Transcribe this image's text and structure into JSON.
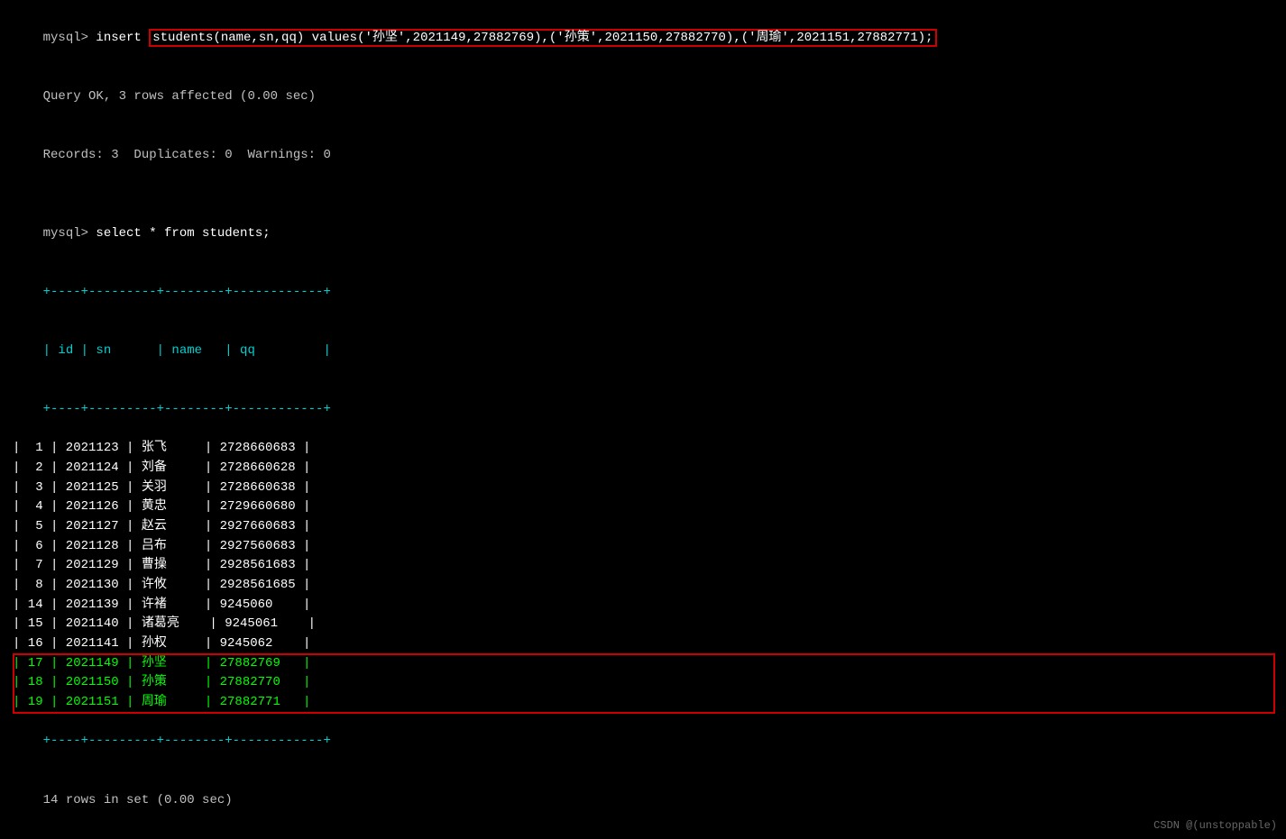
{
  "terminal": {
    "insert_prompt": "mysql> ",
    "insert_cmd_pre": "insert ",
    "insert_cmd_highlight": "students(name,sn,qq) values('孙坚',2021149,27882769),('孙策',2021150,27882770),('周瑜',2021151,27882771);",
    "query_ok": "Query OK, 3 rows affected (0.00 sec)",
    "records": "Records: 3  Duplicates: 0  Warnings: 0",
    "blank1": "",
    "select_prompt": "mysql> ",
    "select_cmd": "select * from students;",
    "sep1": "+----+---------+--------+------------+",
    "header": "| id | sn      | name   | qq         |",
    "sep2": "+----+---------+--------+------------+",
    "rows": [
      {
        "id": " 1",
        "sn": "2021123",
        "name": "张飞",
        "qq": "2728660683",
        "highlight": false
      },
      {
        "id": " 2",
        "sn": "2021124",
        "name": "刘备",
        "qq": "2728660628",
        "highlight": false
      },
      {
        "id": " 3",
        "sn": "2021125",
        "name": "关羽",
        "qq": "2728660638",
        "highlight": false
      },
      {
        "id": " 4",
        "sn": "2021126",
        "name": "黄忠",
        "qq": "2729660680",
        "highlight": false
      },
      {
        "id": " 5",
        "sn": "2021127",
        "name": "赵云",
        "qq": "2927660683",
        "highlight": false
      },
      {
        "id": " 6",
        "sn": "2021128",
        "name": "吕布",
        "qq": "2927560683",
        "highlight": false
      },
      {
        "id": " 7",
        "sn": "2021129",
        "name": "曹操",
        "qq": "2928561683",
        "highlight": false
      },
      {
        "id": " 8",
        "sn": "2021130",
        "name": "许攸",
        "qq": "2928561685",
        "highlight": false
      },
      {
        "id": "14",
        "sn": "2021139",
        "name": "许褚",
        "qq": "9245060   ",
        "highlight": false
      },
      {
        "id": "15",
        "sn": "2021140",
        "name": "诸葛亮",
        "qq": "9245061   ",
        "highlight": false
      },
      {
        "id": "16",
        "sn": "2021141",
        "name": "孙权",
        "qq": "9245062   ",
        "highlight": false
      },
      {
        "id": "17",
        "sn": "2021149",
        "name": "孙坚",
        "qq": "27882769  ",
        "highlight": true
      },
      {
        "id": "18",
        "sn": "2021150",
        "name": "孙策",
        "qq": "27882770  ",
        "highlight": true
      },
      {
        "id": "19",
        "sn": "2021151",
        "name": "周瑜",
        "qq": "27882771  ",
        "highlight": true
      }
    ],
    "sep3": "+----+---------+--------+------------+",
    "footer": "14 rows in set (0.00 sec)",
    "watermark": "CSDN @(unstoppable)"
  }
}
